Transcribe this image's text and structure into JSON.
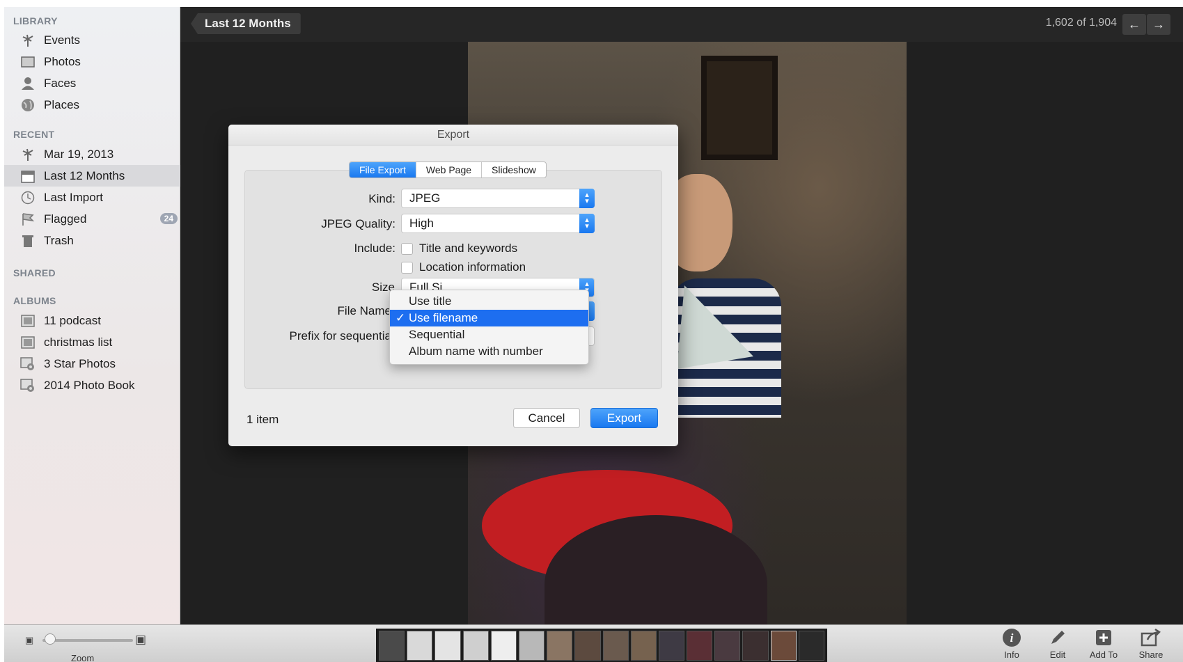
{
  "sidebar": {
    "sections": {
      "library": "LIBRARY",
      "recent": "RECENT",
      "shared": "SHARED",
      "albums": "ALBUMS"
    },
    "library_items": [
      {
        "label": "Events",
        "icon": "palm-tree-icon"
      },
      {
        "label": "Photos",
        "icon": "photo-icon"
      },
      {
        "label": "Faces",
        "icon": "person-icon"
      },
      {
        "label": "Places",
        "icon": "globe-icon"
      }
    ],
    "recent_items": [
      {
        "label": "Mar 19, 2013",
        "icon": "palm-tree-icon"
      },
      {
        "label": "Last 12 Months",
        "icon": "calendar-icon",
        "selected": true
      },
      {
        "label": "Last Import",
        "icon": "clock-icon"
      },
      {
        "label": "Flagged",
        "icon": "flag-icon",
        "badge": "24"
      },
      {
        "label": "Trash",
        "icon": "trash-icon"
      }
    ],
    "album_items": [
      {
        "label": "11 podcast",
        "icon": "album-icon"
      },
      {
        "label": "christmas list",
        "icon": "album-icon"
      },
      {
        "label": "3 Star Photos",
        "icon": "smart-album-icon"
      },
      {
        "label": "2014 Photo Book",
        "icon": "smart-album-icon"
      }
    ]
  },
  "topbar": {
    "breadcrumb": "Last 12 Months",
    "counter": "1,602 of 1,904",
    "prev_icon": "arrow-left-icon",
    "next_icon": "arrow-right-icon"
  },
  "dialog": {
    "title": "Export",
    "tabs": [
      "File Export",
      "Web Page",
      "Slideshow"
    ],
    "active_tab": "File Export",
    "kind_label": "Kind:",
    "kind_value": "JPEG",
    "quality_label": "JPEG Quality:",
    "quality_value": "High",
    "include_label": "Include:",
    "include_options": [
      "Title and keywords",
      "Location information"
    ],
    "size_label": "Size",
    "size_value_partial": "Full Si",
    "filename_label": "File Name",
    "prefix_label": "Prefix for sequentia",
    "filename_menu": [
      "Use title",
      "Use filename",
      "Sequential",
      "Album name with number"
    ],
    "filename_selected": "Use filename",
    "item_count": "1 item",
    "cancel_label": "Cancel",
    "export_label": "Export"
  },
  "bottombar": {
    "zoom_label": "Zoom",
    "tools": [
      {
        "label": "Info",
        "icon": "info-icon"
      },
      {
        "label": "Edit",
        "icon": "pencil-icon"
      },
      {
        "label": "Add To",
        "icon": "plus-icon"
      },
      {
        "label": "Share",
        "icon": "share-icon"
      }
    ]
  },
  "colors": {
    "accent": "#1978f0",
    "sidebar_bg": "#eef0f3",
    "viewer_bg": "#202020"
  }
}
